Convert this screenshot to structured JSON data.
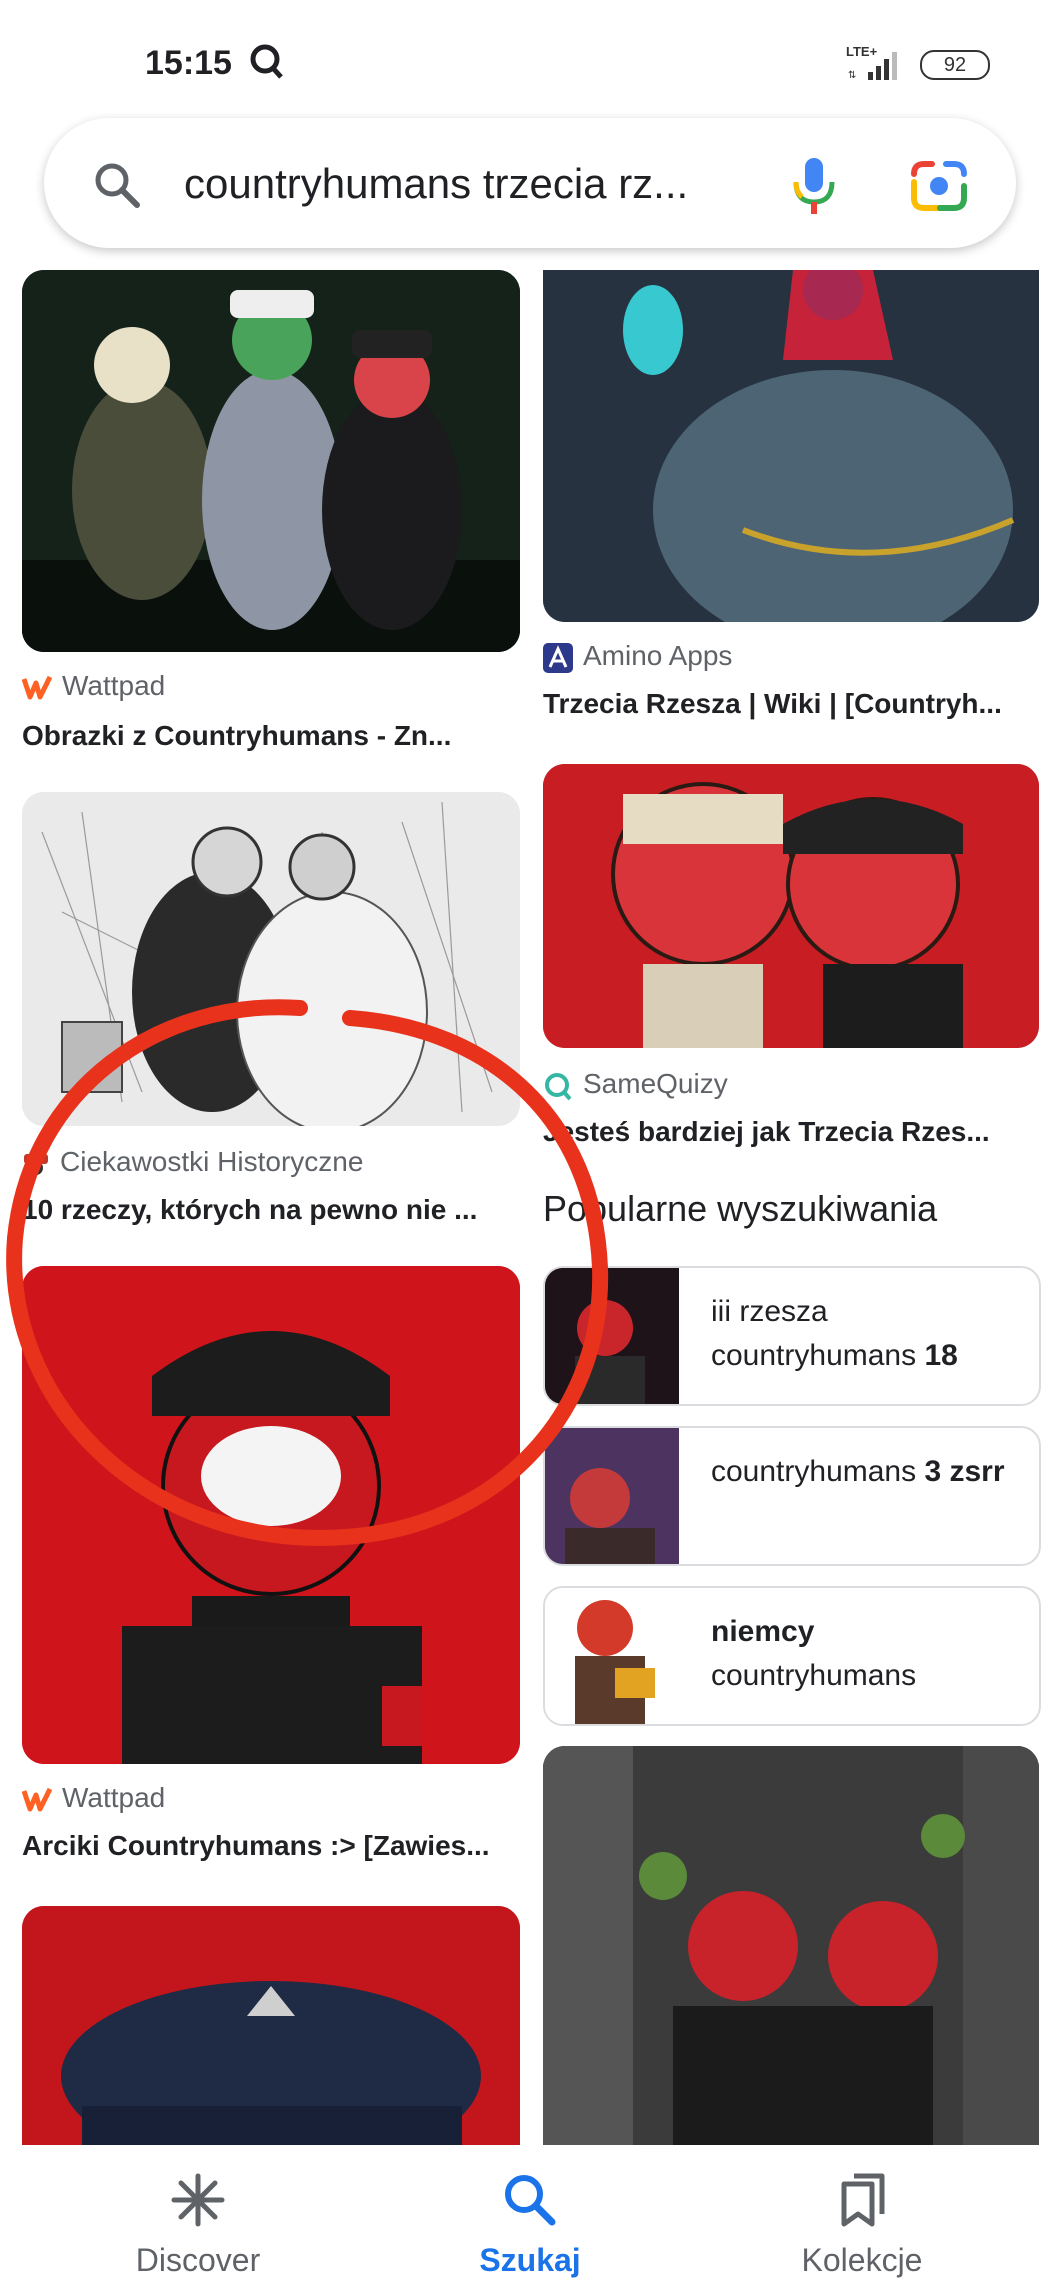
{
  "status_bar": {
    "time": "15:15",
    "network": "LTE+",
    "battery": "92"
  },
  "search": {
    "query": "countryhumans trzecia rz..."
  },
  "results_left": [
    {
      "source": "Wattpad",
      "title": "Obrazki z Countryhumans - Zn..."
    },
    {
      "source": "Ciekawostki Historyczne",
      "title": "10 rzeczy, których na pewno nie ..."
    },
    {
      "source": "Wattpad",
      "title": "Arciki Countryhumans :> [Zawies..."
    }
  ],
  "results_right": [
    {
      "source": "Amino Apps",
      "title": "Trzecia Rzesza | Wiki | [Countryh..."
    },
    {
      "source": "SameQuizy",
      "title": "Jesteś bardziej jak Trzecia Rzes..."
    }
  ],
  "popular": {
    "heading": "Popularne wyszukiwania",
    "items": [
      {
        "normal": "iii rzesza countryhumans ",
        "bold": "18"
      },
      {
        "normal": "countryhumans ",
        "bold": "3 zsrr"
      },
      {
        "bold": "niemcy",
        "normal": " countryhumans"
      }
    ]
  },
  "bottom_nav": {
    "items": [
      {
        "label": "Discover",
        "icon": "asterisk-icon"
      },
      {
        "label": "Szukaj",
        "icon": "search-icon",
        "active": true
      },
      {
        "label": "Kolekcje",
        "icon": "bookmarks-icon"
      }
    ]
  },
  "colors": {
    "accent": "#1a73e8",
    "text": "#202124",
    "secondary": "#5f6368",
    "annotation": "#e8321c"
  }
}
